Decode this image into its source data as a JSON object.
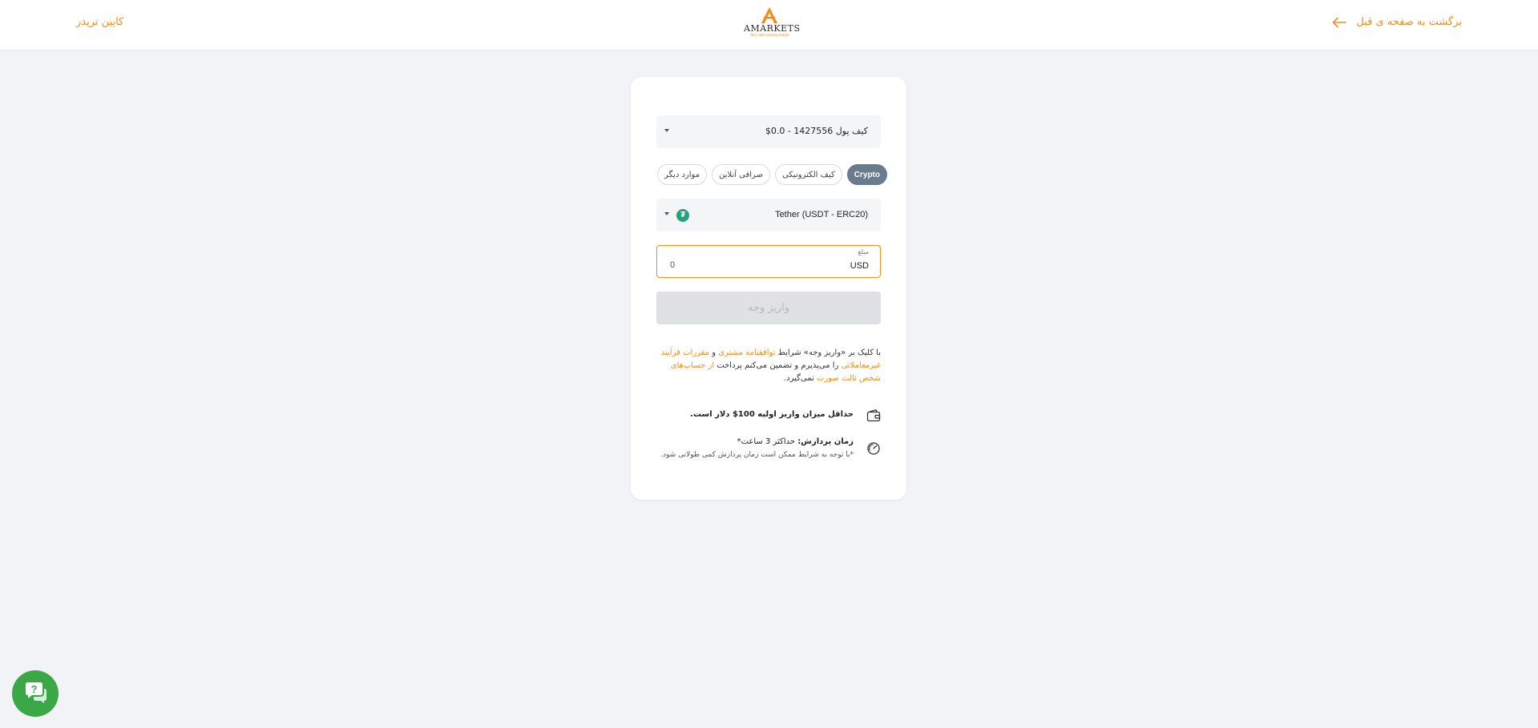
{
  "header": {
    "cabin_link": "کابین تریدر",
    "back_link": "برگشت به صفحه ی قبل",
    "logo_text": "AMARKETS",
    "logo_tagline": "Your safe trading choice"
  },
  "form": {
    "wallet_select": "کیف پول 1427556 - 0.0$",
    "chips": [
      "Crypto",
      "کیف الکترونیکی",
      "صرافی آنلاین",
      "موارد دیگر"
    ],
    "method_select": "Tether (USDT - ERC20)",
    "amount": {
      "label": "مبلغ",
      "currency": "USD",
      "value": "0"
    },
    "deposit_button": "واریز وجه"
  },
  "terms": {
    "part1": "با کلیک بر «واریز وجه» شرایط ",
    "link1": "توافقنامه مشتری",
    "part2": " و ",
    "link2": "مقررات فرآیند غیرمعاملاتی",
    "part3": " را می‌پذیرم و تضمین می‌کنم پرداخت ",
    "link3": "از حساب‌های شخص ثالث صورت",
    "part4": " نمی‌گیرد."
  },
  "info": {
    "min_deposit": "حداقل میزان واریز اولیه 100$ دلار است.",
    "processing_label": "زمان پردازش:",
    "processing_value": " حداکثر 3 ساعت*",
    "processing_note": "*با توجه به شرایط ممکن است زمان پردازش کمی طولانی شود."
  },
  "colors": {
    "accent": "#f08c1d",
    "chip_active": "#6b7b8e",
    "support": "#3aa845",
    "tether": "#26a17b"
  }
}
